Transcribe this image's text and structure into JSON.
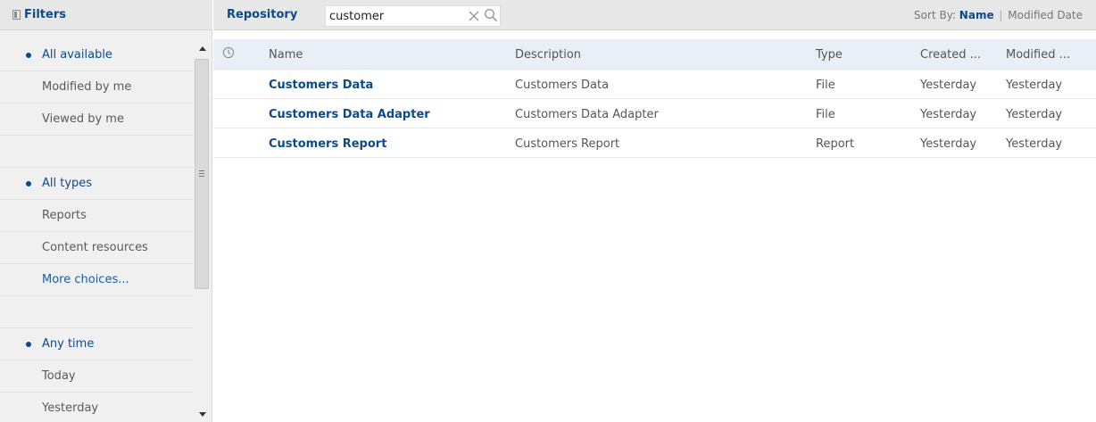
{
  "filters": {
    "title": "Filters",
    "items": [
      {
        "label": "All available",
        "active": true
      },
      {
        "label": "Modified by me",
        "active": false
      },
      {
        "label": "Viewed by me",
        "active": false
      },
      {
        "label": "",
        "spacer": true
      },
      {
        "label": "All types",
        "active": true
      },
      {
        "label": "Reports",
        "active": false
      },
      {
        "label": "Content resources",
        "active": false
      },
      {
        "label": "More choices...",
        "link": true
      },
      {
        "label": "",
        "spacer": true
      },
      {
        "label": "Any time",
        "active": true
      },
      {
        "label": "Today",
        "active": false
      },
      {
        "label": "Yesterday",
        "active": false
      }
    ]
  },
  "toolbar": {
    "title": "Repository",
    "search": {
      "value": "customer",
      "placeholder": ""
    },
    "sort_label": "Sort By:",
    "sort_name": "Name",
    "sort_separator": "|",
    "sort_modified": "Modified Date"
  },
  "table": {
    "columns": {
      "name": "Name",
      "description": "Description",
      "type": "Type",
      "created": "Created ...",
      "modified": "Modified ..."
    },
    "rows": [
      {
        "name": "Customers Data",
        "description": "Customers Data",
        "type": "File",
        "created": "Yesterday",
        "modified": "Yesterday"
      },
      {
        "name": "Customers Data Adapter",
        "description": "Customers Data Adapter",
        "type": "File",
        "created": "Yesterday",
        "modified": "Yesterday"
      },
      {
        "name": "Customers Report",
        "description": "Customers Report",
        "type": "Report",
        "created": "Yesterday",
        "modified": "Yesterday"
      }
    ]
  },
  "colors": {
    "accent": "#0d4a8a",
    "panel": "#f0f0f0",
    "header": "#e7e7e7",
    "table_header": "#e9eff7"
  }
}
